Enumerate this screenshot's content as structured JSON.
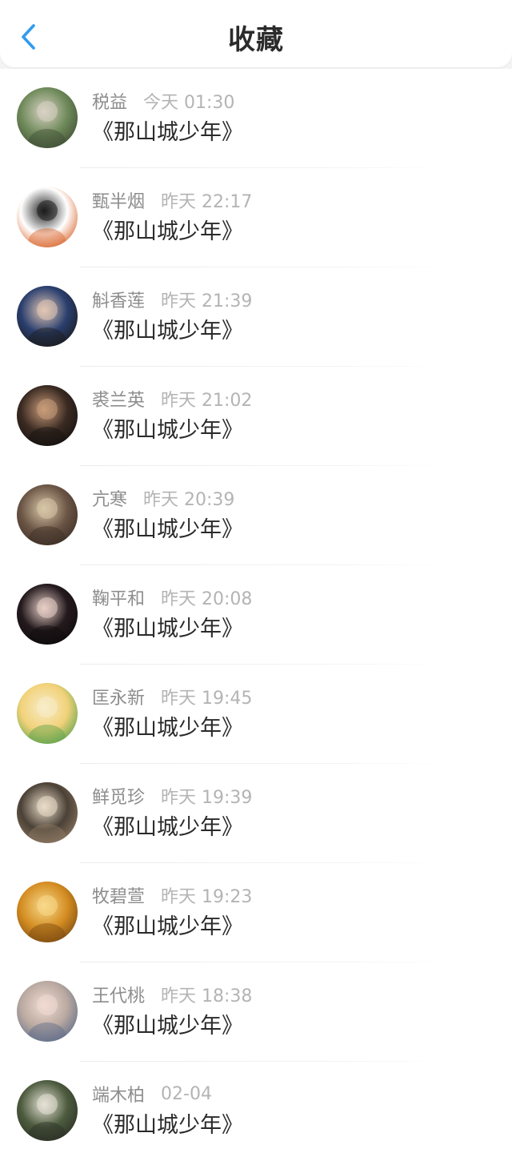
{
  "header": {
    "title": "收藏"
  },
  "favorites": [
    {
      "name": "税益",
      "time": "今天 01:30",
      "work": "《那山城少年》",
      "avatar_colors": [
        "#6f8a5a",
        "#d9d2c4",
        "#3e4c35"
      ]
    },
    {
      "name": "甄半烟",
      "time": "昨天 22:17",
      "work": "《那山城少年》",
      "avatar_colors": [
        "#ffffff",
        "#1c1c1c",
        "#d9642b"
      ]
    },
    {
      "name": "斛香莲",
      "time": "昨天 21:39",
      "work": "《那山城少年》",
      "avatar_colors": [
        "#2a3f6e",
        "#e2c7b5",
        "#1a1a1a"
      ]
    },
    {
      "name": "裘兰英",
      "time": "昨天 21:02",
      "work": "《那山城少年》",
      "avatar_colors": [
        "#3a2a22",
        "#c99c7a",
        "#15110f"
      ]
    },
    {
      "name": "亢寒",
      "time": "昨天 20:39",
      "work": "《那山城少年》",
      "avatar_colors": [
        "#6b5545",
        "#d8c7a8",
        "#3b2e26"
      ]
    },
    {
      "name": "鞠平和",
      "time": "昨天 20:08",
      "work": "《那山城少年》",
      "avatar_colors": [
        "#241a1e",
        "#e8cfc7",
        "#0e0a0c"
      ]
    },
    {
      "name": "匡永新",
      "time": "昨天 19:45",
      "work": "《那山城少年》",
      "avatar_colors": [
        "#f2d27a",
        "#f7ecc8",
        "#58a24c"
      ]
    },
    {
      "name": "鲜觅珍",
      "time": "昨天 19:39",
      "work": "《那山城少年》",
      "avatar_colors": [
        "#4b4136",
        "#e9dcc8",
        "#8e7a63"
      ]
    },
    {
      "name": "牧碧萱",
      "time": "昨天 19:23",
      "work": "《那山城少年》",
      "avatar_colors": [
        "#d48d22",
        "#f7d98a",
        "#7a4a12"
      ]
    },
    {
      "name": "王代桃",
      "time": "昨天 18:38",
      "work": "《那山城少年》",
      "avatar_colors": [
        "#b9a9a0",
        "#f1dbd2",
        "#5d6b8a"
      ]
    },
    {
      "name": "端木柏",
      "time": "02-04",
      "work": "《那山城少年》",
      "avatar_colors": [
        "#4d5b3e",
        "#e5e2d6",
        "#2a2f26"
      ]
    }
  ],
  "colors": {
    "accent": "#2f9cf0",
    "title": "#2b2b2b",
    "name": "#8d8d8d",
    "time": "#b4b4b4",
    "work": "#2a2a2a",
    "background": "#ffffff"
  },
  "icons": {
    "back": "chevron-left-icon"
  }
}
